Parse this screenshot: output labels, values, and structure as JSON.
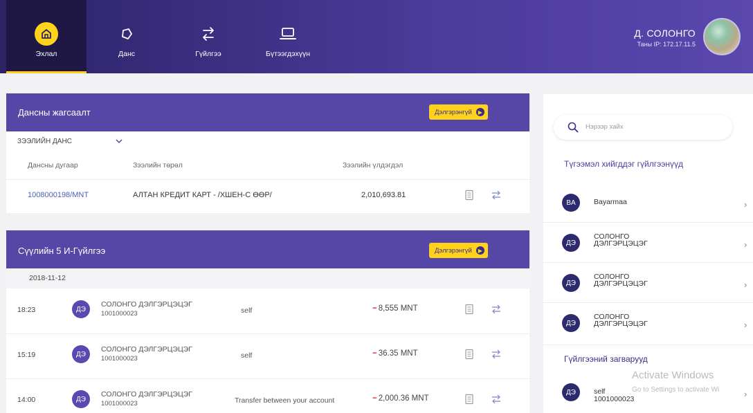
{
  "nav": {
    "items": [
      {
        "label": "Эхлал",
        "icon": "home-icon"
      },
      {
        "label": "Данс",
        "icon": "account-icon"
      },
      {
        "label": "Гүйлгээ",
        "icon": "transfer-icon"
      },
      {
        "label": "Бүтээгдэхүүн",
        "icon": "laptop-icon"
      }
    ],
    "user_name": "Д. СОЛОНГО",
    "user_ip": "Таны IP: 172.17.11.5"
  },
  "accounts": {
    "title": "Дансны жагсаалт",
    "more_label": "Дэлгэрэнгүй",
    "filter": "ЗЭЭЛИЙН ДАНС",
    "columns": [
      "Дансны дугаар",
      "Зээлийн төрөл",
      "Зээлийн үлдэгдэл"
    ],
    "rows": [
      {
        "number": "1008000198/MNT",
        "type": "АЛТАН КРЕДИТ КАРТ - /ХШЕН-С ӨӨР/",
        "balance": "2,010,693.81"
      }
    ]
  },
  "recent": {
    "title": "Сүүлийн 5 И-Гүйлгээ",
    "more_label": "Дэлгэрэнгүй",
    "date": "2018-11-12",
    "transactions": [
      {
        "time": "18:23",
        "initials": "ДЭ",
        "name": "СОЛОНГО ДЭЛГЭРЦЭЦЭГ",
        "account": "1001000023",
        "desc": "self",
        "amount": "8,555 MNT"
      },
      {
        "time": "15:19",
        "initials": "ДЭ",
        "name": "СОЛОНГО ДЭЛГЭРЦЭЦЭГ",
        "account": "1001000023",
        "desc": "self",
        "amount": "36.35 MNT"
      },
      {
        "time": "14:00",
        "initials": "ДЭ",
        "name": "СОЛОНГО ДЭЛГЭРЦЭЦЭГ",
        "account": "1001000023",
        "desc": "Transfer between your account",
        "amount": "2,000.36 MNT"
      }
    ]
  },
  "right": {
    "search_placeholder": "Нэрээр хайх",
    "frequent_title": "Түгээмэл хийгддэг гүйлгээнүүд",
    "frequent": [
      {
        "initials": "BA",
        "name1": "Bayarmaa",
        "name2": ""
      },
      {
        "initials": "ДЭ",
        "name1": "СОЛОНГО",
        "name2": "ДЭЛГЭРЦЭЦЭГ"
      },
      {
        "initials": "ДЭ",
        "name1": "СОЛОНГО",
        "name2": "ДЭЛГЭРЦЭЦЭГ"
      },
      {
        "initials": "ДЭ",
        "name1": "СОЛОНГО",
        "name2": "ДЭЛГЭРЦЭЦЭГ"
      }
    ],
    "templates_title": "Гүйлгээний загварууд",
    "templates": [
      {
        "initials": "ДЭ",
        "name1": "self",
        "name2": "1001000023"
      }
    ]
  },
  "watermark": {
    "line1": "Activate Windows",
    "line2": "Go to Settings to activate Wi"
  },
  "colors": {
    "nav_dark": "#2c2366",
    "accent_yellow": "#ffd21c",
    "card_head": "#5647a6",
    "minus_red": "#e0202a"
  }
}
